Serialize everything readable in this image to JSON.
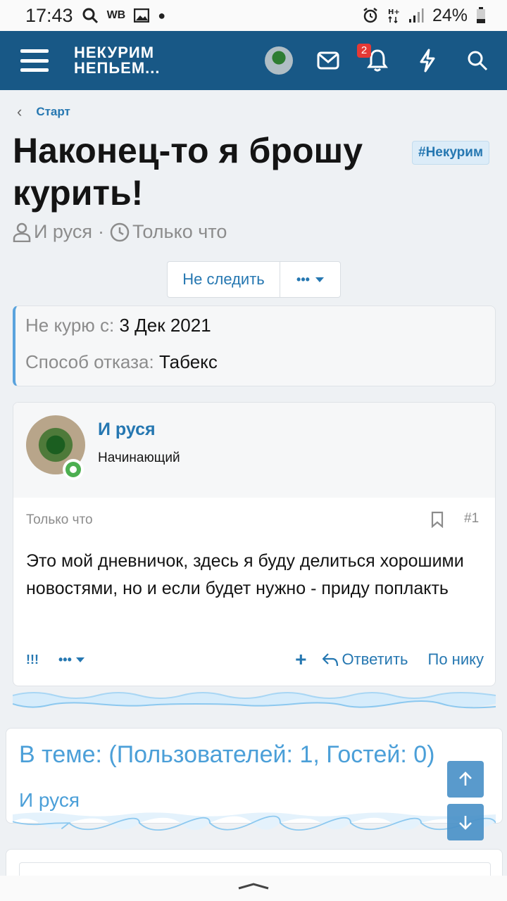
{
  "status_bar": {
    "time": "17:43",
    "wb_label": "WB",
    "battery": "24%",
    "icons": [
      "search-icon",
      "image-icon",
      "alarm-icon",
      "signal-icon",
      "battery-icon"
    ]
  },
  "header": {
    "logo_line1": "НЕКУРИМ",
    "logo_line2": "НЕПЬЕМ...",
    "notifications_count": "2",
    "icons": [
      "menu-icon",
      "avatar",
      "mail-icon",
      "bell-icon",
      "bolt-icon",
      "search-icon"
    ],
    "accent_color": "#185886"
  },
  "breadcrumb": {
    "label": "Старт"
  },
  "thread": {
    "title": "Наконец-то я брошу курить!",
    "tag": "#Некурим",
    "author": "И руся",
    "separator": "·",
    "time": "Только что",
    "follow_label": "Не следить",
    "more_label": "•••"
  },
  "fields": {
    "quit_label": "Не курю с:",
    "quit_value": "3 Дек 2021",
    "method_label": "Способ отказа:",
    "method_value": "Табекс"
  },
  "post": {
    "username": "И руся",
    "role": "Начинающий",
    "time": "Только что",
    "number": "#1",
    "body": "Это мой дневничок, здесь я буду делиться хорошими новостями, но и если будет нужно - приду поплакть",
    "exclaim": "!!!",
    "more_label": "•••",
    "plus": "+",
    "reply_label": "Ответить",
    "bynick_label": "По нику"
  },
  "online": {
    "title": "В теме: (Пользователей: 1, Гостей: 0)",
    "users": [
      "И руся"
    ]
  }
}
